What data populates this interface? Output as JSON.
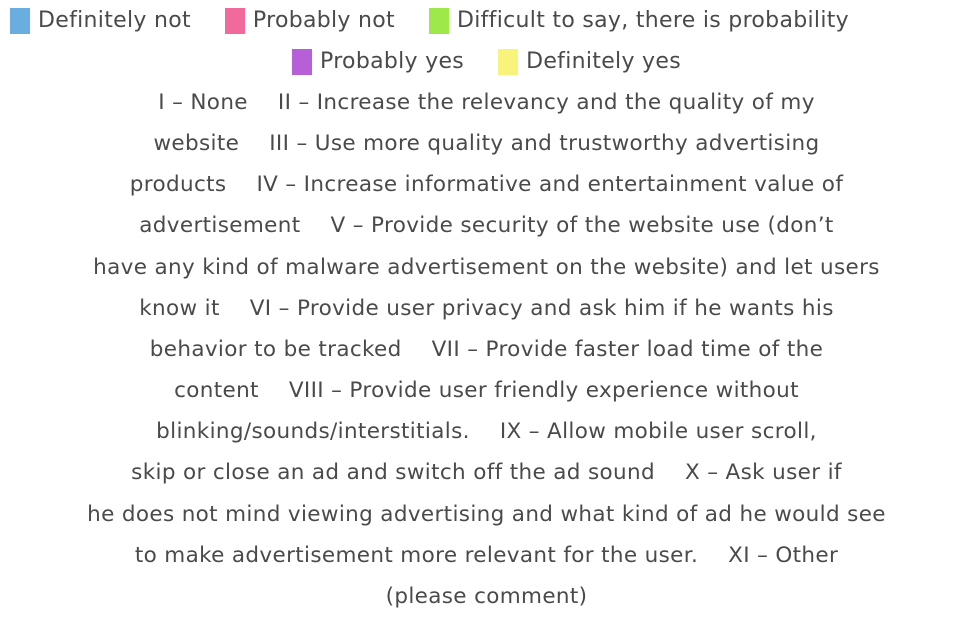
{
  "chart_data": {
    "type": "bar",
    "legend_placement": "top",
    "legend": [
      {
        "label": "Definitely not",
        "color": "#6aaee0"
      },
      {
        "label": "Probably not",
        "color": "#f26a9c"
      },
      {
        "label": "Difficult to say, there is probability",
        "color": "#9fe84a"
      },
      {
        "label": "Probably yes",
        "color": "#b75fd6"
      },
      {
        "label": "Definitely yes",
        "color": "#f8f37a"
      }
    ],
    "note_lines": [
      [
        "I – None",
        "II – Increase the relevancy and the quality of my"
      ],
      [
        "website",
        "III – Use more quality and trustworthy advertising"
      ],
      [
        "products",
        "IV – Increase informative and entertainment value of"
      ],
      [
        "advertisement",
        "V – Provide security of the website use (don’t"
      ],
      [
        "have any kind of malware advertisement on the website) and let users"
      ],
      [
        "know it",
        "VI – Provide user privacy and ask him if he wants his"
      ],
      [
        "behavior to be tracked",
        "VII – Provide faster load time of the"
      ],
      [
        "content",
        "VIII – Provide user friendly experience without"
      ],
      [
        "blinking/sounds/interstitials.",
        "IX – Allow mobile user scroll,"
      ],
      [
        "skip or close an ad and switch off the ad sound",
        "X – Ask user if"
      ],
      [
        "he does not mind viewing advertising and what kind of ad he would see"
      ],
      [
        "to make advertisement more relevant for the user.",
        "XI – Other"
      ],
      [
        "(please comment)"
      ]
    ]
  }
}
